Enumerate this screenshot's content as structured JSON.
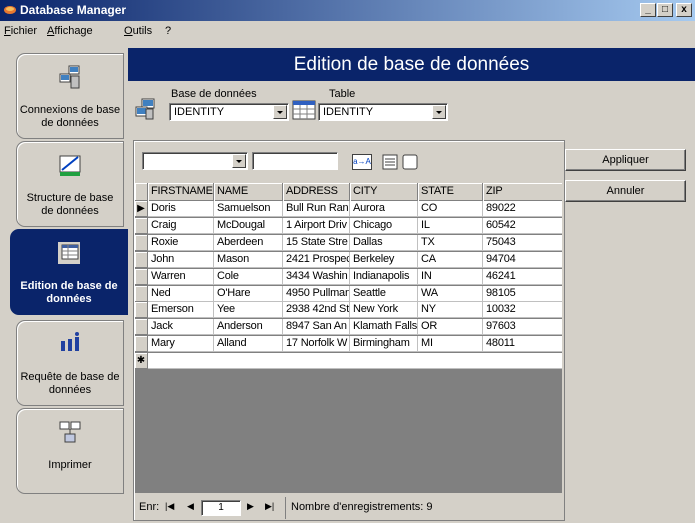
{
  "window": {
    "title": "Database Manager",
    "min": "_",
    "max": "□",
    "close": "x"
  },
  "menu": [
    {
      "label": "Fichier",
      "u": "F",
      "rest": "ichier"
    },
    {
      "label": "Affichage",
      "u": "A",
      "rest": "ffichage"
    },
    {
      "label": "Outils",
      "u": "O",
      "rest": "utils"
    },
    {
      "label": "?",
      "u": "",
      "rest": "?"
    }
  ],
  "sidebar": [
    {
      "label": "Connexions de base de données",
      "icon": "connection-icon",
      "active": false
    },
    {
      "label": "Structure de base de données",
      "icon": "structure-icon",
      "active": false
    },
    {
      "label": "Edition de base de données",
      "icon": "table-edit-icon",
      "active": true
    },
    {
      "label": "Requête de base de données",
      "icon": "query-icon",
      "active": false
    },
    {
      "label": "Imprimer",
      "icon": "print-icon",
      "active": false
    }
  ],
  "header": {
    "title": "Edition de base de données"
  },
  "fields": {
    "database_label": "Base de données",
    "database_value": "IDENTITY",
    "table_label": "Table",
    "table_value": "IDENTITY"
  },
  "filter": {
    "sort_label": "a→A"
  },
  "grid": {
    "columns": [
      "FIRSTNAME",
      "NAME",
      "ADDRESS",
      "CITY",
      "STATE",
      "ZIP"
    ],
    "rows": [
      [
        "Doris",
        "Samuelson",
        "Bull Run Ran",
        "Aurora",
        "CO",
        "89022"
      ],
      [
        "Craig",
        "McDougal",
        "1 Airport Driv",
        "Chicago",
        "IL",
        "60542"
      ],
      [
        "Roxie",
        "Aberdeen",
        "15 State Stre",
        "Dallas",
        "TX",
        "75043"
      ],
      [
        "John",
        "Mason",
        "2421 Prospec",
        "Berkeley",
        "CA",
        "94704"
      ],
      [
        "Warren",
        "Cole",
        "3434 Washin",
        "Indianapolis",
        "IN",
        "46241"
      ],
      [
        "Ned",
        "O'Hare",
        "4950 Pullman",
        "Seattle",
        "WA",
        "98105"
      ],
      [
        "Emerson",
        "Yee",
        "2938 42nd Str",
        "New York",
        "NY",
        "10032"
      ],
      [
        "Jack",
        "Anderson",
        "8947 San An",
        "Klamath Falls",
        "OR",
        "97603"
      ],
      [
        "Mary",
        "Alland",
        "17 Norfolk W",
        "Birmingham",
        "MI",
        "48011"
      ]
    ],
    "current_marker": "▶",
    "new_marker": "✱"
  },
  "navigator": {
    "label": "Enr:",
    "first": "|◀",
    "prev": "◀",
    "current": "1",
    "next": "▶",
    "last": "▶|",
    "count_text": "Nombre d'enregistrements: 9"
  },
  "actions": {
    "apply": "Appliquer",
    "cancel": "Annuler"
  }
}
